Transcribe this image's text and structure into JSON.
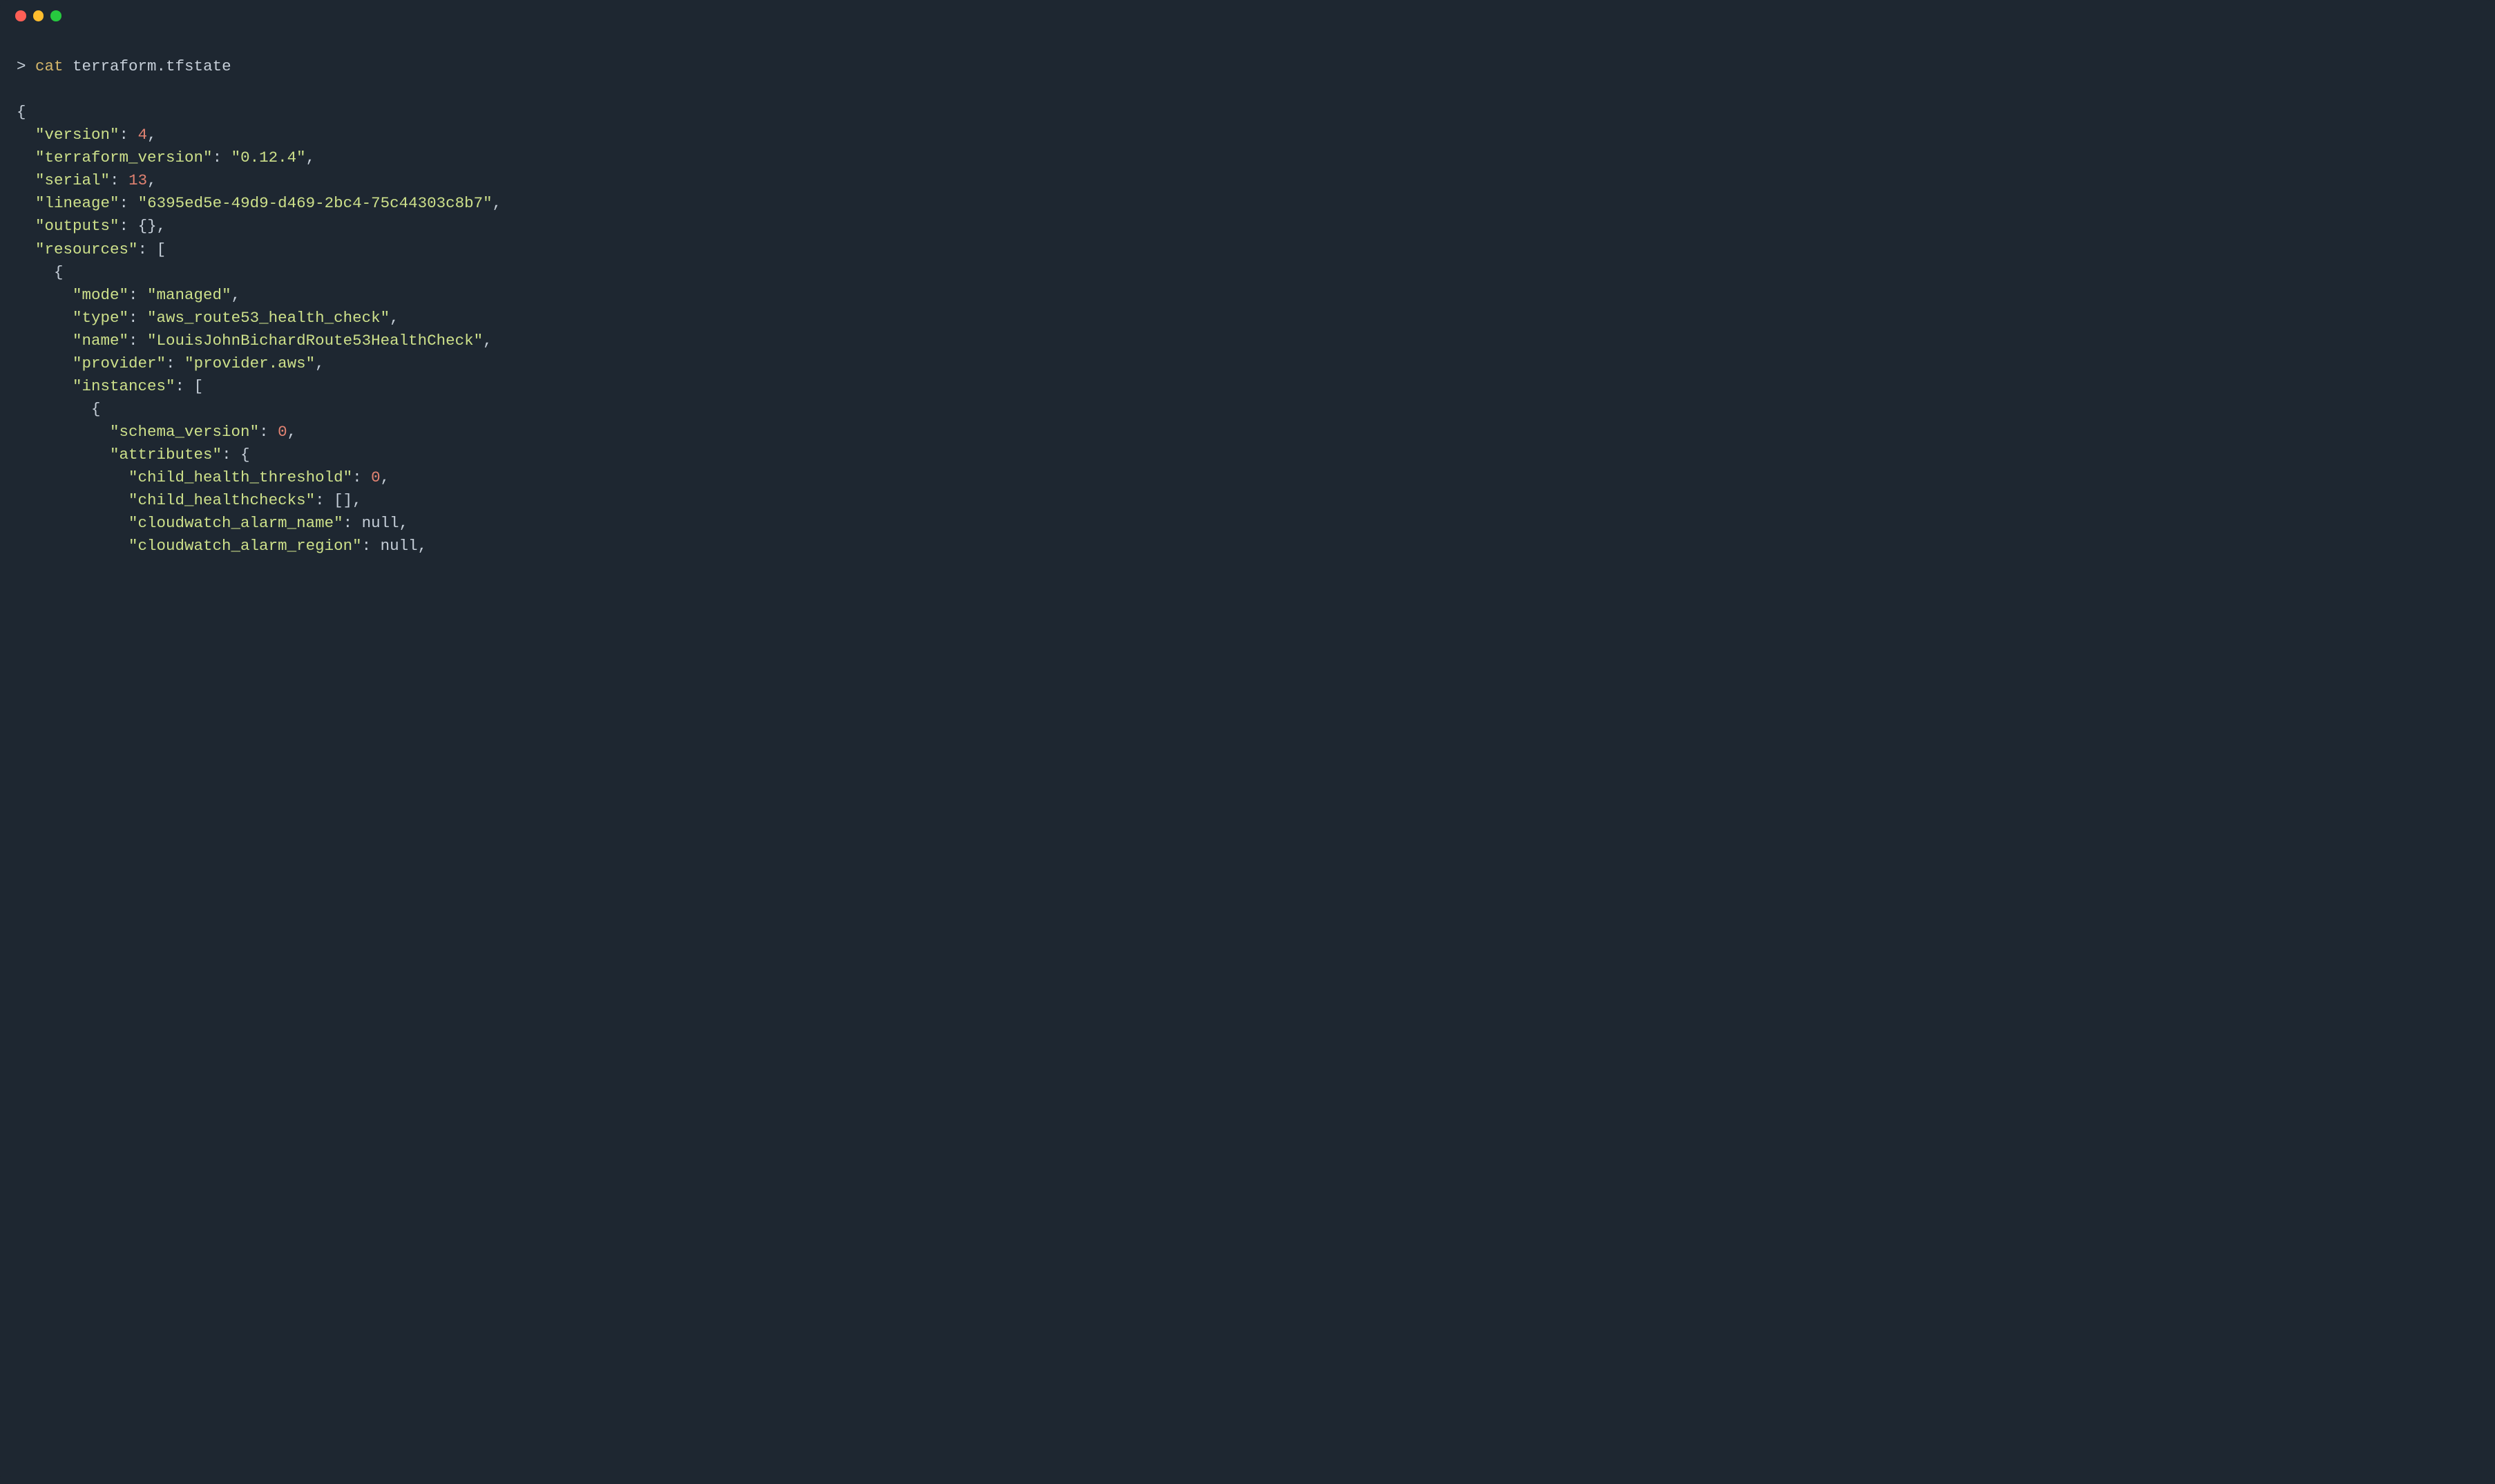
{
  "prompt": "> ",
  "command": "cat",
  "arg": " terraform.tfstate",
  "lines": {
    "l0": "{",
    "l1_k": "\"version\"",
    "l1_v": "4",
    "l2_k": "\"terraform_version\"",
    "l2_v": "\"0.12.4\"",
    "l3_k": "\"serial\"",
    "l3_v": "13",
    "l4_k": "\"lineage\"",
    "l4_v": "\"6395ed5e-49d9-d469-2bc4-75c44303c8b7\"",
    "l5_k": "\"outputs\"",
    "l5_v": "{}",
    "l6_k": "\"resources\"",
    "l6_v": "[",
    "l7": "    {",
    "l8_k": "\"mode\"",
    "l8_v": "\"managed\"",
    "l9_k": "\"type\"",
    "l9_v": "\"aws_route53_health_check\"",
    "l10_k": "\"name\"",
    "l10_v": "\"LouisJohnBichardRoute53HealthCheck\"",
    "l11_k": "\"provider\"",
    "l11_v": "\"provider.aws\"",
    "l12_k": "\"instances\"",
    "l12_v": "[",
    "l13": "        {",
    "l14_k": "\"schema_version\"",
    "l14_v": "0",
    "l15_k": "\"attributes\"",
    "l15_v": "{",
    "l16_k": "\"child_health_threshold\"",
    "l16_v": "0",
    "l17_k": "\"child_healthchecks\"",
    "l17_v": "[]",
    "l18_k": "\"cloudwatch_alarm_name\"",
    "l18_v": "null",
    "l19_k": "\"cloudwatch_alarm_region\"",
    "l19_v": "null"
  },
  "indent": {
    "i2": "  ",
    "i6": "      ",
    "i10": "          ",
    "i12": "            "
  },
  "colors": {
    "background": "#1e2731",
    "text": "#c5ced8",
    "command": "#d4b66a",
    "string_key": "#cde08a",
    "number": "#e28372"
  }
}
